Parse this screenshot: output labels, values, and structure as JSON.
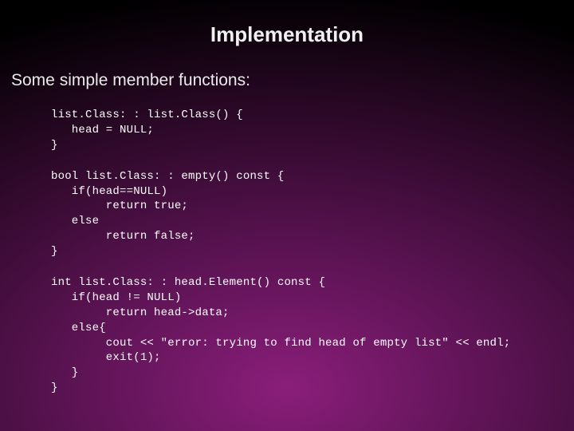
{
  "slide": {
    "title": "Implementation",
    "subtitle": "Some simple member functions:",
    "code1": "list.Class: : list.Class() {\n   head = NULL;\n}",
    "code2": "bool list.Class: : empty() const {\n   if(head==NULL)\n        return true;\n   else\n        return false;\n}",
    "code3": "int list.Class: : head.Element() const {\n   if(head != NULL)\n        return head->data;\n   else{\n        cout << \"error: trying to find head of empty list\" << endl;\n        exit(1);\n   }\n}"
  }
}
